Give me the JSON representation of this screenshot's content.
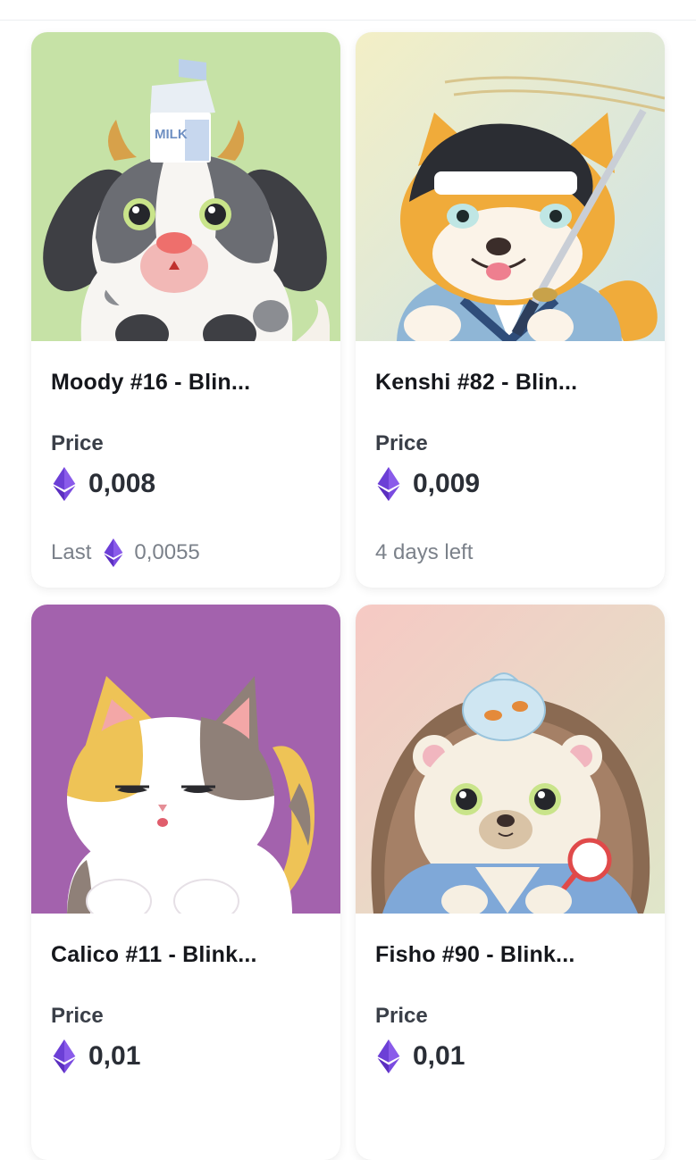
{
  "accent_color": "#6c4fd8",
  "cards": [
    {
      "title": "Moody #16 - Blin...",
      "price_label": "Price",
      "price_value": "0,008",
      "footer_prefix": "Last",
      "footer_value": "0,0055",
      "currency_icon": "ethereum-icon",
      "background": "#c6e2a6"
    },
    {
      "title": "Kenshi #82 - Blin...",
      "price_label": "Price",
      "price_value": "0,009",
      "footer_text": "4 days left",
      "currency_icon": "ethereum-icon",
      "background": "#dcebe0"
    },
    {
      "title": "Calico #11 - Blink...",
      "price_label": "Price",
      "price_value": "0,01",
      "currency_icon": "ethereum-icon",
      "background": "#a362ad"
    },
    {
      "title": "Fisho #90 - Blink...",
      "price_label": "Price",
      "price_value": "0,01",
      "currency_icon": "ethereum-icon",
      "background": "#f2d9cf"
    }
  ]
}
